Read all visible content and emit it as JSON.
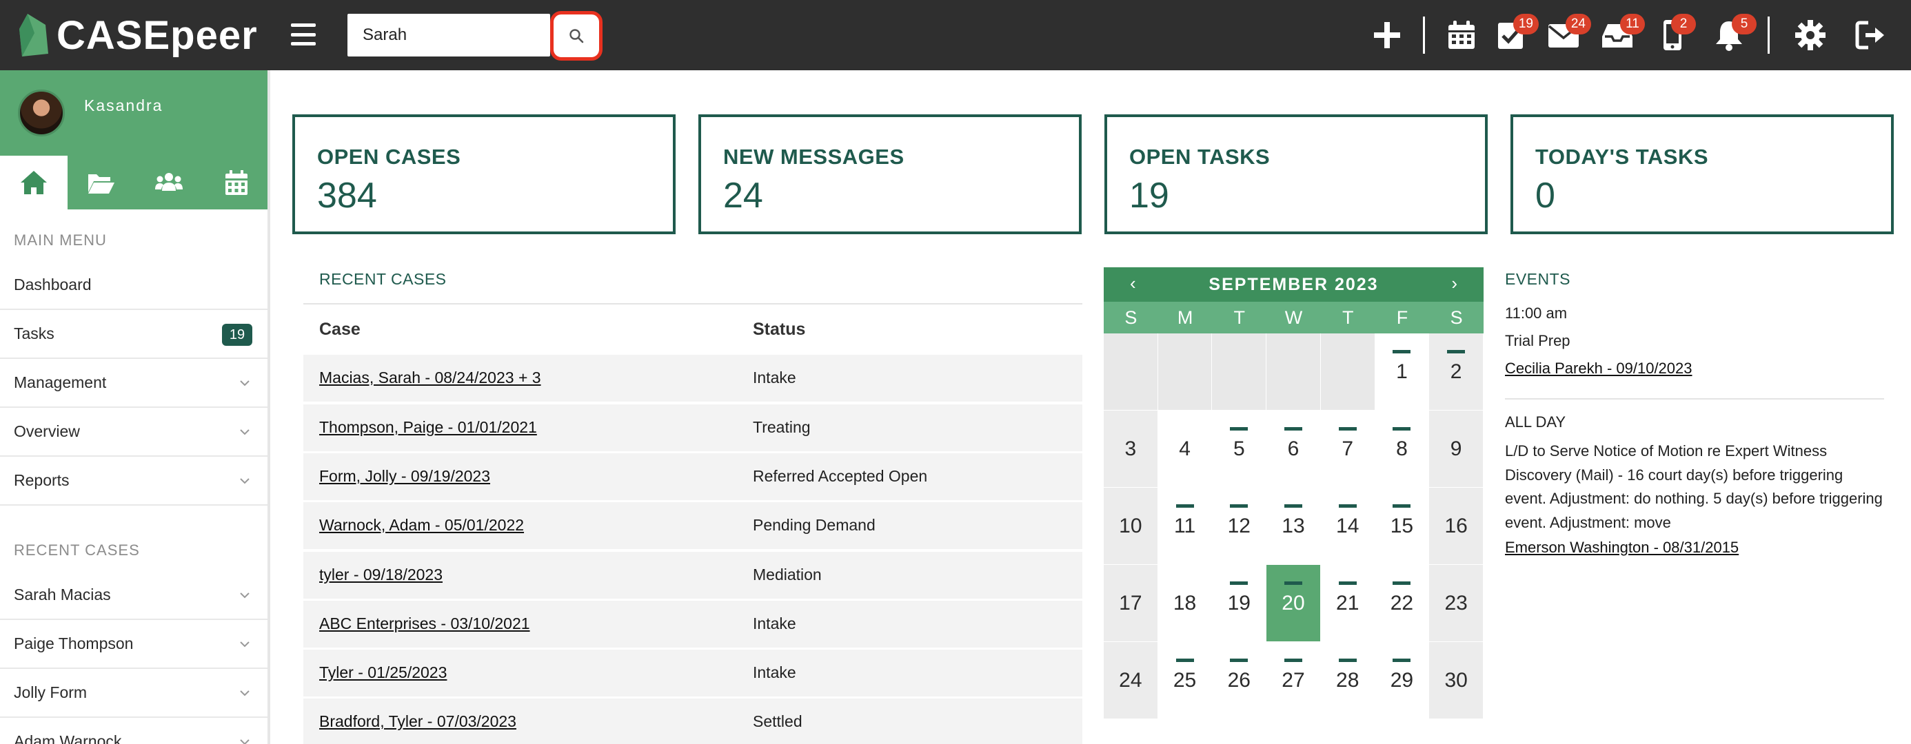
{
  "app": {
    "name": "CASEpeer"
  },
  "topbar": {
    "search_value": "Sarah",
    "icons": [
      {
        "name": "plus-icon",
        "badge": ""
      },
      {
        "name": "calendar-icon",
        "badge": ""
      },
      {
        "name": "tasks-check-icon",
        "badge": "19"
      },
      {
        "name": "mail-icon",
        "badge": "24"
      },
      {
        "name": "inbox-icon",
        "badge": "11"
      },
      {
        "name": "phone-icon",
        "badge": "2"
      },
      {
        "name": "bell-icon",
        "badge": "5"
      },
      {
        "name": "gear-icon",
        "badge": ""
      },
      {
        "name": "logout-icon",
        "badge": ""
      }
    ]
  },
  "user": {
    "name": "Kasandra"
  },
  "sidebar": {
    "main_menu_heading": "MAIN MENU",
    "main_menu": [
      {
        "label": "Dashboard",
        "badge": "",
        "expandable": false
      },
      {
        "label": "Tasks",
        "badge": "19",
        "expandable": false
      },
      {
        "label": "Management",
        "badge": "",
        "expandable": true
      },
      {
        "label": "Overview",
        "badge": "",
        "expandable": true
      },
      {
        "label": "Reports",
        "badge": "",
        "expandable": true
      }
    ],
    "recent_heading": "RECENT CASES",
    "recent_cases": [
      {
        "label": "Sarah Macias"
      },
      {
        "label": "Paige Thompson"
      },
      {
        "label": "Jolly Form"
      },
      {
        "label": "Adam Warnock"
      }
    ]
  },
  "stats": [
    {
      "label": "OPEN CASES",
      "value": "384"
    },
    {
      "label": "NEW MESSAGES",
      "value": "24"
    },
    {
      "label": "OPEN TASKS",
      "value": "19"
    },
    {
      "label": "TODAY'S TASKS",
      "value": "0"
    }
  ],
  "recent_cases_table": {
    "title": "RECENT CASES",
    "columns": [
      "Case",
      "Status"
    ],
    "rows": [
      {
        "case": "Macias, Sarah - 08/24/2023 + 3",
        "status": "Intake"
      },
      {
        "case": "Thompson, Paige - 01/01/2021",
        "status": "Treating"
      },
      {
        "case": "Form, Jolly - 09/19/2023",
        "status": "Referred Accepted Open"
      },
      {
        "case": "Warnock, Adam - 05/01/2022",
        "status": "Pending Demand"
      },
      {
        "case": "tyler - 09/18/2023",
        "status": "Mediation"
      },
      {
        "case": "ABC Enterprises - 03/10/2021",
        "status": "Intake"
      },
      {
        "case": "Tyler - 01/25/2023",
        "status": "Intake"
      },
      {
        "case": "Bradford, Tyler - 07/03/2023",
        "status": "Settled"
      }
    ]
  },
  "calendar": {
    "month_label": "SEPTEMBER 2023",
    "prev": "‹",
    "next": "›",
    "weekdays": [
      "S",
      "M",
      "T",
      "W",
      "T",
      "F",
      "S"
    ],
    "leading_blanks": 5,
    "days_in_month": 30,
    "today": 20,
    "event_days": [
      1,
      2,
      5,
      6,
      7,
      8,
      11,
      12,
      13,
      14,
      15,
      19,
      20,
      21,
      22,
      25,
      26,
      27,
      28,
      29
    ]
  },
  "events": {
    "title": "EVENTS",
    "items": [
      {
        "time": "11:00 am",
        "name": "Trial Prep",
        "link": "Cecilia Parekh - 09/10/2023"
      },
      {
        "time": "ALL DAY",
        "name": "L/D to Serve Notice of Motion re Expert Witness Discovery (Mail) - 16 court day(s) before triggering event. Adjustment: do nothing. 5 day(s) before triggering event. Adjustment: move",
        "link": "Emerson Washington - 08/31/2015"
      }
    ]
  },
  "colors": {
    "topbar": "#2f2f2f",
    "brand_green": "#5aa872",
    "dark_teal": "#1f5a4d",
    "badge_red": "#d9402a",
    "highlight_red": "#e8311f"
  }
}
